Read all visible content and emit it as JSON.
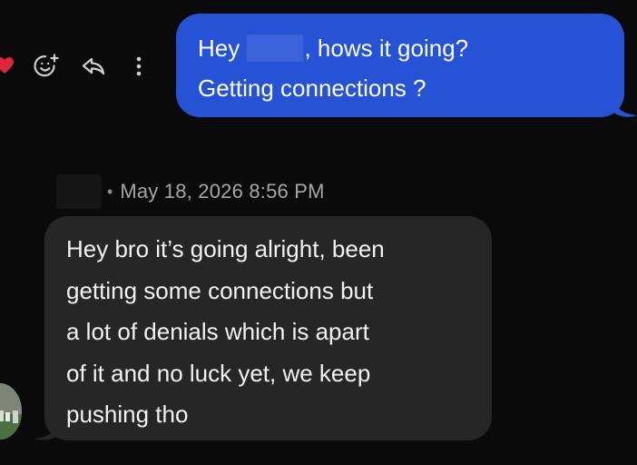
{
  "outgoing": {
    "text_before_name": "Hey ",
    "text_after_name": ", hows it going?",
    "line2": "Getting connections ?"
  },
  "incoming": {
    "timestamp": "May 18, 2026 8:56 PM",
    "separator": "•",
    "lines": [
      "Hey bro it’s going alright, been",
      "getting some connections but",
      "a lot of denials which is apart",
      "of it and no luck yet, we keep",
      "pushing tho"
    ]
  },
  "colors": {
    "outgoing_bubble": "#2653d6",
    "incoming_bubble": "#262626",
    "background": "#0a0a0a",
    "heart": "#e0263a"
  },
  "icons": [
    "heart-icon",
    "add-reaction-icon",
    "reply-icon",
    "more-options-icon"
  ]
}
